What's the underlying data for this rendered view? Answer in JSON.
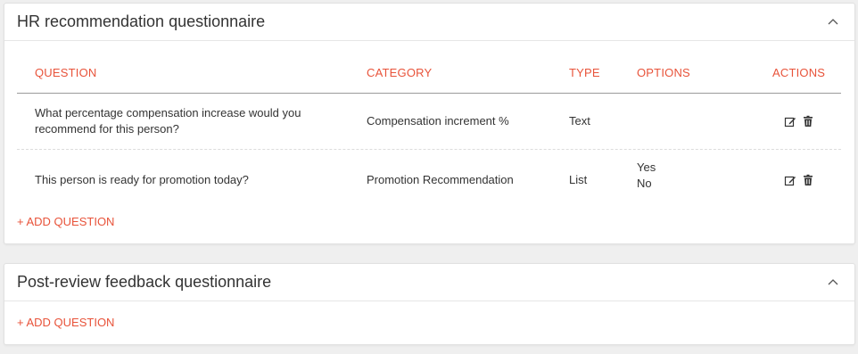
{
  "sections": [
    {
      "title": "HR recommendation questionnaire",
      "columns": [
        "QUESTION",
        "CATEGORY",
        "TYPE",
        "OPTIONS",
        "ACTIONS"
      ],
      "rows": [
        {
          "question_line1": "What percentage compensation increase would you",
          "question_line2": "recommend for this person?",
          "category": "Compensation increment %",
          "type": "Text",
          "options": []
        },
        {
          "question": "This person is ready for promotion today?",
          "category": "Promotion Recommendation",
          "type": "List",
          "options": [
            "Yes",
            "No"
          ]
        }
      ],
      "add_label": "+ ADD QUESTION",
      "collapse_icon": "chevron-up-icon"
    },
    {
      "title": "Post-review feedback questionnaire",
      "add_label": "+ ADD QUESTION",
      "collapse_icon": "chevron-up-icon"
    }
  ],
  "colors": {
    "accent": "#e8533a",
    "text": "#333333",
    "background": "#efefef"
  },
  "icons": {
    "edit": "edit-icon",
    "delete": "trash-icon"
  }
}
